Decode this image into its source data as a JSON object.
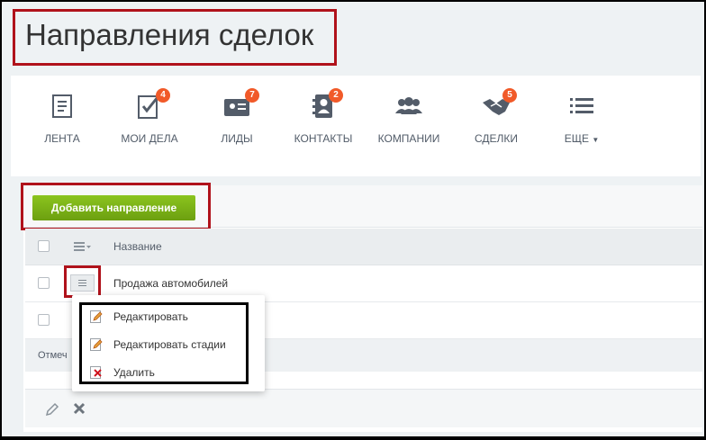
{
  "page": {
    "title": "Направления сделок"
  },
  "nav": {
    "items": [
      {
        "id": "feed",
        "label": "ЛЕНТА",
        "icon": "feed-icon",
        "badge": ""
      },
      {
        "id": "tasks",
        "label": "МОИ ДЕЛА",
        "icon": "tasks-icon",
        "badge": "4"
      },
      {
        "id": "leads",
        "label": "ЛИДЫ",
        "icon": "leads-icon",
        "badge": "7"
      },
      {
        "id": "contacts",
        "label": "КОНТАКТЫ",
        "icon": "contacts-icon",
        "badge": "2"
      },
      {
        "id": "companies",
        "label": "КОМПАНИИ",
        "icon": "companies-icon",
        "badge": ""
      },
      {
        "id": "deals",
        "label": "СДЕЛКИ",
        "icon": "deals-icon",
        "badge": "5"
      },
      {
        "id": "more",
        "label": "ЕЩЕ",
        "icon": "more-icon",
        "badge": ""
      }
    ]
  },
  "toolbar": {
    "add_label": "Добавить направление"
  },
  "grid": {
    "header": {
      "name_label": "Название"
    },
    "rows": [
      {
        "name": "Продажа автомобилей"
      },
      {
        "name": ""
      }
    ],
    "footer_text": "Отмеч"
  },
  "context_menu": {
    "items": [
      {
        "label": "Редактировать",
        "icon": "edit-icon"
      },
      {
        "label": "Редактировать стадии",
        "icon": "edit-stages-icon"
      },
      {
        "label": "Удалить",
        "icon": "delete-icon"
      }
    ]
  },
  "colors": {
    "accent_green": "#7ab317",
    "badge": "#f15a29",
    "highlight": "#b0121b"
  }
}
